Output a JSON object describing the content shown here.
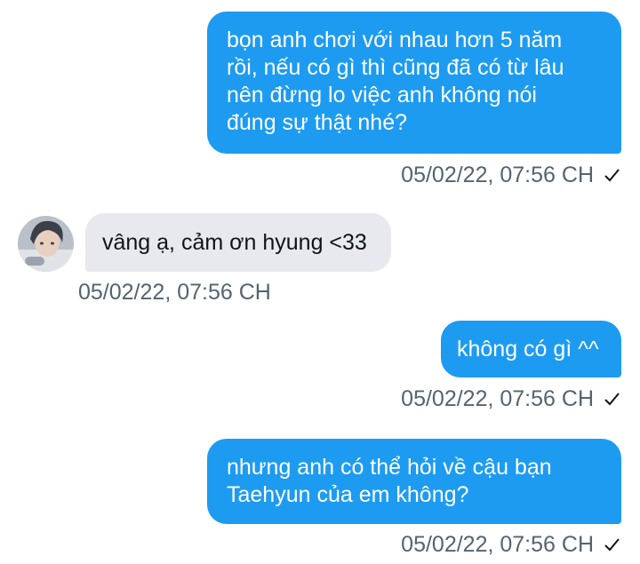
{
  "messages": [
    {
      "direction": "outgoing",
      "text": "bọn anh chơi với nhau hơn 5 năm\nrồi, nếu có gì thì cũng đã có từ lâu\nnên đừng lo việc anh không nói\nđúng sự thật nhé?",
      "timestamp": "05/02/22, 07:56 CH",
      "status_icon": "check-icon"
    },
    {
      "direction": "incoming",
      "text": "vâng ạ, cảm ơn hyung <33",
      "timestamp": "05/02/22, 07:56 CH",
      "avatar_icon": "avatar"
    },
    {
      "direction": "outgoing",
      "text": "không có gì ^^",
      "timestamp": "05/02/22, 07:56 CH",
      "status_icon": "check-icon"
    },
    {
      "direction": "outgoing",
      "text": "nhưng anh có thể hỏi về cậu bạn\nTaehyun của em không?",
      "timestamp": "05/02/22, 07:56 CH",
      "status_icon": "check-icon"
    }
  ],
  "colors": {
    "outgoing_bubble": "#1d9bf0",
    "incoming_bubble": "#e7e9ee",
    "timestamp_text": "#536471",
    "background": "#ffffff"
  }
}
